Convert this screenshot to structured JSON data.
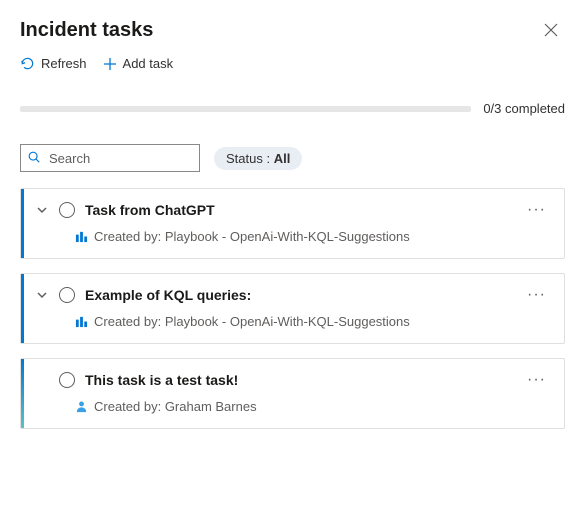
{
  "header": {
    "title": "Incident tasks"
  },
  "toolbar": {
    "refresh_label": "Refresh",
    "add_task_label": "Add task"
  },
  "progress": {
    "label": "0/3 completed"
  },
  "filters": {
    "search_placeholder": "Search",
    "status_prefix": "Status : ",
    "status_value": "All"
  },
  "tasks": [
    {
      "title": "Task from ChatGPT",
      "created_by_label": "Created by: Playbook - OpenAi-With-KQL-Suggestions",
      "source": "playbook",
      "accent": "blue",
      "expandable": true
    },
    {
      "title": "Example of KQL queries:",
      "created_by_label": "Created by: Playbook - OpenAi-With-KQL-Suggestions",
      "source": "playbook",
      "accent": "blue",
      "expandable": true
    },
    {
      "title": "This task is a test task!",
      "created_by_label": "Created by: Graham Barnes",
      "source": "user",
      "accent": "cyan",
      "expandable": false
    }
  ]
}
